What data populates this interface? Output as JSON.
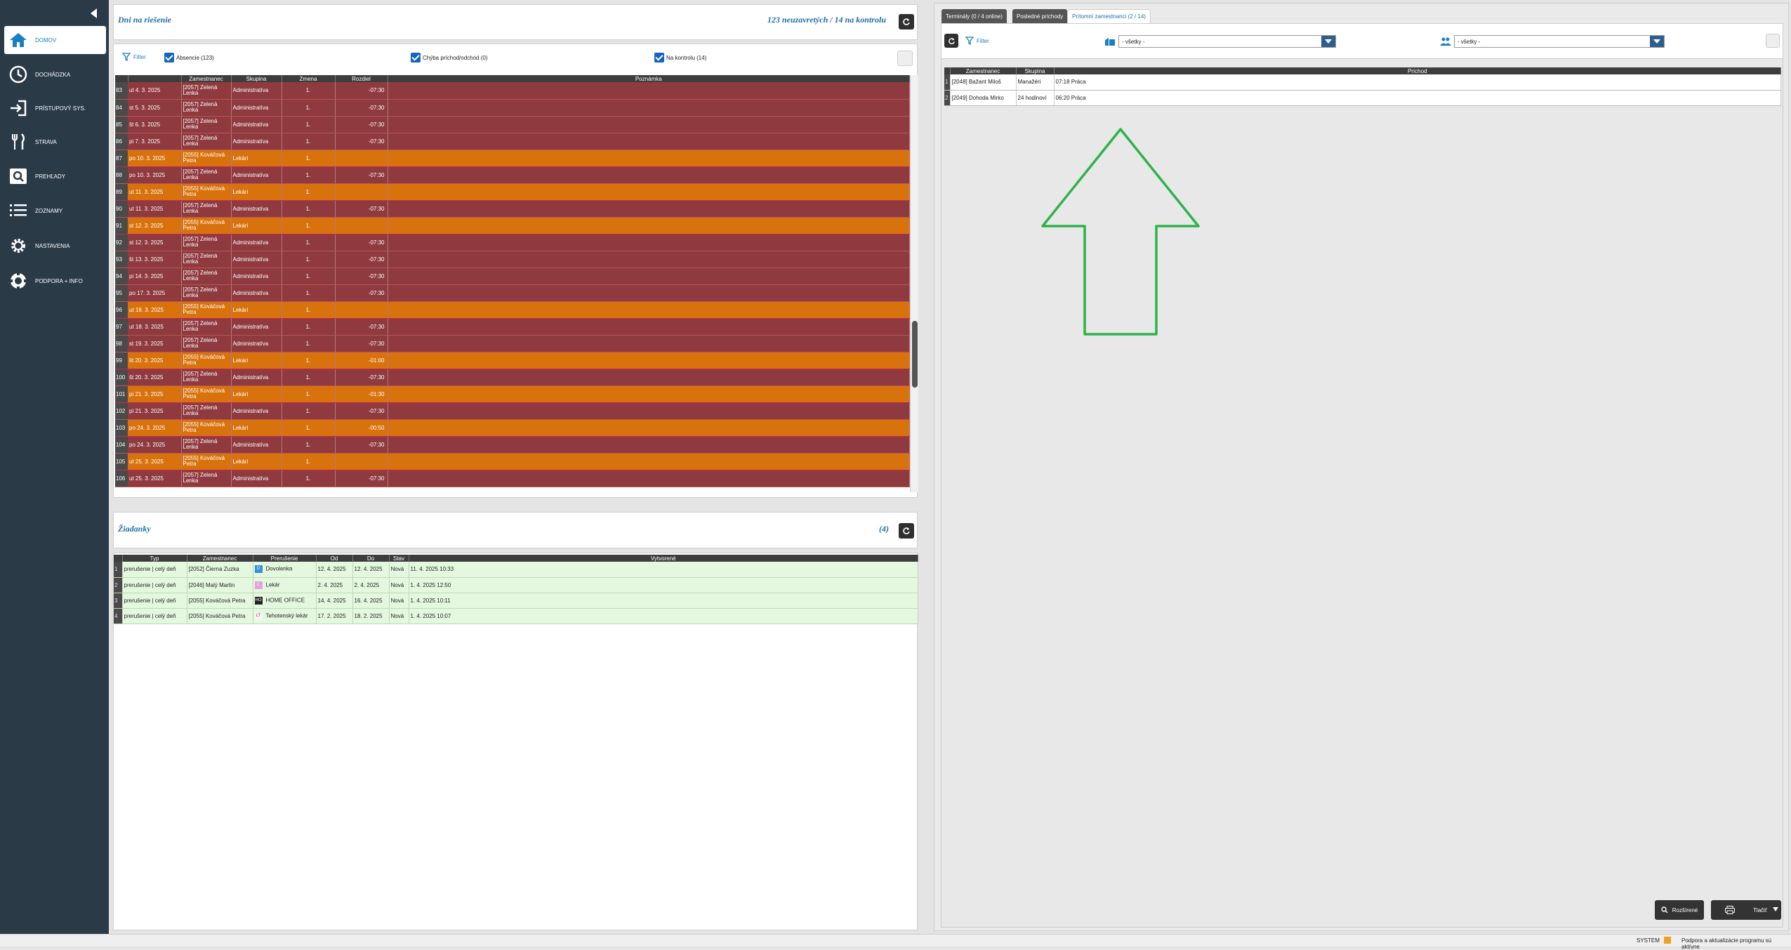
{
  "sidebar": {
    "items": [
      {
        "label": "Domov",
        "icon": "home-icon",
        "active": true
      },
      {
        "label": "Dochádzka",
        "icon": "clock-icon"
      },
      {
        "label": "Prístupový sys.",
        "icon": "login-icon"
      },
      {
        "label": "Strava",
        "icon": "cutlery-icon"
      },
      {
        "label": "Prehľady",
        "icon": "magnifier-icon"
      },
      {
        "label": "Zoznamy",
        "icon": "list-icon"
      },
      {
        "label": "Nastavenia",
        "icon": "gear-icon"
      },
      {
        "label": "Podpora + info",
        "icon": "lifebuoy-icon"
      }
    ]
  },
  "days_panel": {
    "title": "Dni na riešenie",
    "summary": "123 neuzavretých / 14 na kontrolu",
    "filter_label": "Filter",
    "checks": [
      "Absencie (123)",
      "Chýba príchod/odchod (0)",
      "Na kontrolu (14)"
    ],
    "columns": [
      "",
      "Zamestnanec",
      "Skupina",
      "Zmena",
      "Rozdiel",
      "Poznámka"
    ],
    "rows": [
      {
        "n": "83",
        "date": "ut 4. 3. 2025",
        "emp": "[2057] Zelená Lenka",
        "group": "Administratíva",
        "shift": "1.",
        "diff": "-07:30",
        "color": "red"
      },
      {
        "n": "84",
        "date": "st 5. 3. 2025",
        "emp": "[2057] Zelená Lenka",
        "group": "Administratíva",
        "shift": "1.",
        "diff": "-07:30",
        "color": "red"
      },
      {
        "n": "85",
        "date": "št 6. 3. 2025",
        "emp": "[2057] Zelená Lenka",
        "group": "Administratíva",
        "shift": "1.",
        "diff": "-07:30",
        "color": "red"
      },
      {
        "n": "86",
        "date": "pi 7. 3. 2025",
        "emp": "[2057] Zelená Lenka",
        "group": "Administratíva",
        "shift": "1.",
        "diff": "-07:30",
        "color": "red"
      },
      {
        "n": "87",
        "date": "po 10. 3. 2025",
        "emp": "[2055] Kováčová Petra",
        "group": "Lekári",
        "shift": "1.",
        "diff": "",
        "color": "orange"
      },
      {
        "n": "88",
        "date": "po 10. 3. 2025",
        "emp": "[2057] Zelená Lenka",
        "group": "Administratíva",
        "shift": "1.",
        "diff": "-07:30",
        "color": "red"
      },
      {
        "n": "89",
        "date": "ut 11. 3. 2025",
        "emp": "[2055] Kováčová Petra",
        "group": "Lekári",
        "shift": "1.",
        "diff": "",
        "color": "orange"
      },
      {
        "n": "90",
        "date": "ut 11. 3. 2025",
        "emp": "[2057] Zelená Lenka",
        "group": "Administratíva",
        "shift": "1.",
        "diff": "-07:30",
        "color": "red"
      },
      {
        "n": "91",
        "date": "st 12. 3. 2025",
        "emp": "[2055] Kováčová Petra",
        "group": "Lekári",
        "shift": "1.",
        "diff": "",
        "color": "orange"
      },
      {
        "n": "92",
        "date": "st 12. 3. 2025",
        "emp": "[2057] Zelená Lenka",
        "group": "Administratíva",
        "shift": "1.",
        "diff": "-07:30",
        "color": "red"
      },
      {
        "n": "93",
        "date": "št 13. 3. 2025",
        "emp": "[2057] Zelená Lenka",
        "group": "Administratíva",
        "shift": "1.",
        "diff": "-07:30",
        "color": "red"
      },
      {
        "n": "94",
        "date": "pi 14. 3. 2025",
        "emp": "[2057] Zelená Lenka",
        "group": "Administratíva",
        "shift": "1.",
        "diff": "-07:30",
        "color": "red"
      },
      {
        "n": "95",
        "date": "po 17. 3. 2025",
        "emp": "[2057] Zelená Lenka",
        "group": "Administratíva",
        "shift": "1.",
        "diff": "-07:30",
        "color": "red"
      },
      {
        "n": "96",
        "date": "ut 18. 3. 2025",
        "emp": "[2055] Kováčová Petra",
        "group": "Lekári",
        "shift": "1.",
        "diff": "",
        "color": "orange"
      },
      {
        "n": "97",
        "date": "ut 18. 3. 2025",
        "emp": "[2057] Zelená Lenka",
        "group": "Administratíva",
        "shift": "1.",
        "diff": "-07:30",
        "color": "red"
      },
      {
        "n": "98",
        "date": "st 19. 3. 2025",
        "emp": "[2057] Zelená Lenka",
        "group": "Administratíva",
        "shift": "1.",
        "diff": "-07:30",
        "color": "red"
      },
      {
        "n": "99",
        "date": "št 20. 3. 2025",
        "emp": "[2055] Kováčová Petra",
        "group": "Lekári",
        "shift": "1.",
        "diff": "-01:00",
        "color": "orange"
      },
      {
        "n": "100",
        "date": "št 20. 3. 2025",
        "emp": "[2057] Zelená Lenka",
        "group": "Administratíva",
        "shift": "1.",
        "diff": "-07:30",
        "color": "red"
      },
      {
        "n": "101",
        "date": "pi 21. 3. 2025",
        "emp": "[2055] Kováčová Petra",
        "group": "Lekári",
        "shift": "1.",
        "diff": "-01:30",
        "color": "orange"
      },
      {
        "n": "102",
        "date": "pi 21. 3. 2025",
        "emp": "[2057] Zelená Lenka",
        "group": "Administratíva",
        "shift": "1.",
        "diff": "-07:30",
        "color": "red"
      },
      {
        "n": "103",
        "date": "po 24. 3. 2025",
        "emp": "[2055] Kováčová Petra",
        "group": "Lekári",
        "shift": "1.",
        "diff": "-00:50",
        "color": "orange"
      },
      {
        "n": "104",
        "date": "po 24. 3. 2025",
        "emp": "[2057] Zelená Lenka",
        "group": "Administratíva",
        "shift": "1.",
        "diff": "-07:30",
        "color": "red"
      },
      {
        "n": "105",
        "date": "ut 25. 3. 2025",
        "emp": "[2055] Kováčová Petra",
        "group": "Lekári",
        "shift": "1.",
        "diff": "",
        "color": "orange"
      },
      {
        "n": "106",
        "date": "ut 25. 3. 2025",
        "emp": "[2057] Zelená Lenka",
        "group": "Administratíva",
        "shift": "1.",
        "diff": "-07:30",
        "color": "red"
      }
    ]
  },
  "requests_panel": {
    "title": "Žiadanky",
    "count": "(4)",
    "columns": [
      "",
      "Typ",
      "Zamestnanec",
      "Prerušenie",
      "Od",
      "Do",
      "Stav",
      "Vytvorené"
    ],
    "rows": [
      {
        "n": "1",
        "type": "prerušenie | celý deň",
        "emp": "[2052] Čierna Zuzka",
        "abs": "Dovolenka",
        "abs_code": "D",
        "abs_color": "#3b8fd9",
        "from": "12. 4. 2025",
        "to": "12. 4. 2025",
        "state": "Nová",
        "created": "11. 4. 2025  10:33"
      },
      {
        "n": "2",
        "type": "prerušenie | celý deň",
        "emp": "[2046] Malý Martin",
        "abs": "Lekár",
        "abs_code": "L",
        "abs_color": "#e8a0e0",
        "from": "2. 4. 2025",
        "to": "2. 4. 2025",
        "state": "Nová",
        "created": "1. 4. 2025  12:50"
      },
      {
        "n": "3",
        "type": "prerušenie | celý deň",
        "emp": "[2055] Kováčová Petra",
        "abs": "HOME OFFICE",
        "abs_code": "HO",
        "abs_color": "#222",
        "from": "14. 4. 2025",
        "to": "16. 4. 2025",
        "state": "Nová",
        "created": "1. 4. 2025  10:11"
      },
      {
        "n": "4",
        "type": "prerušenie | celý deň",
        "emp": "[2055] Kováčová Petra",
        "abs": "Tehotenský lekár",
        "abs_code": "LT",
        "abs_color": "#f4f4f4",
        "from": "17. 2. 2025",
        "to": "18. 2. 2025",
        "state": "Nová",
        "created": "1. 4. 2025  10:07"
      }
    ]
  },
  "right_panel": {
    "tabs": [
      "Terminály (0 / 4 online)",
      "Posledné príchody",
      "Prítomní zamestnanci (2 / 14)"
    ],
    "filter_label": "Filter",
    "select1": "- všetky -",
    "select2": "- všetky -",
    "columns": [
      "",
      "Zamestnanec",
      "Skupina",
      "Príchod"
    ],
    "rows": [
      {
        "n": "1",
        "emp": "[2048] Bažant Miloš",
        "group": "Manažéri",
        "arrival": "07:18 Práca"
      },
      {
        "n": "2",
        "emp": "[2049] Dohoda Mirko",
        "group": "24 hodinoví",
        "arrival": "06:20 Práca"
      }
    ],
    "btn_extended": "Rozšírené",
    "btn_print": "Tlačiť"
  },
  "statusbar": {
    "user": "SYSTEM",
    "message": "Podpora a aktualizácie programu sú aktívne"
  },
  "colors": {
    "arrow": "#2db34a",
    "row_red": "#8e3a3f",
    "row_orange": "#d8720c",
    "sidebar": "#2b3a47"
  }
}
